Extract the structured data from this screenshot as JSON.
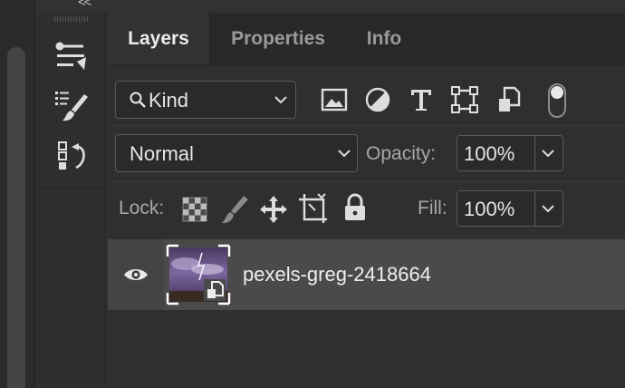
{
  "collapse_glyph": "<<",
  "tabs": [
    {
      "label": "Layers",
      "active": true
    },
    {
      "label": "Properties",
      "active": false
    },
    {
      "label": "Info",
      "active": false
    }
  ],
  "filter": {
    "kind_label": "Kind",
    "icons": [
      "image-filter-icon",
      "adjustment-filter-icon",
      "type-filter-icon",
      "shape-filter-icon",
      "smart-object-filter-icon",
      "filter-toggle"
    ]
  },
  "blend": {
    "mode": "Normal",
    "opacity_label": "Opacity:",
    "opacity_value": "100%"
  },
  "lock": {
    "label": "Lock:",
    "icons": [
      "lock-transparent-pixels-icon",
      "lock-image-pixels-icon",
      "lock-position-icon",
      "lock-artboard-icon",
      "lock-all-icon"
    ],
    "fill_label": "Fill:",
    "fill_value": "100%"
  },
  "layers": [
    {
      "name": "pexels-greg-2418664",
      "visible": true,
      "smart_object": true
    }
  ],
  "tools": [
    "adjustments-panel-icon",
    "brush-presets-icon",
    "history-icon"
  ],
  "colors": {
    "panel_bg": "#2f2f2f",
    "tab_bar_bg": "#282828",
    "selected_row": "#4a4a4a",
    "text": "#e6e6e6"
  }
}
